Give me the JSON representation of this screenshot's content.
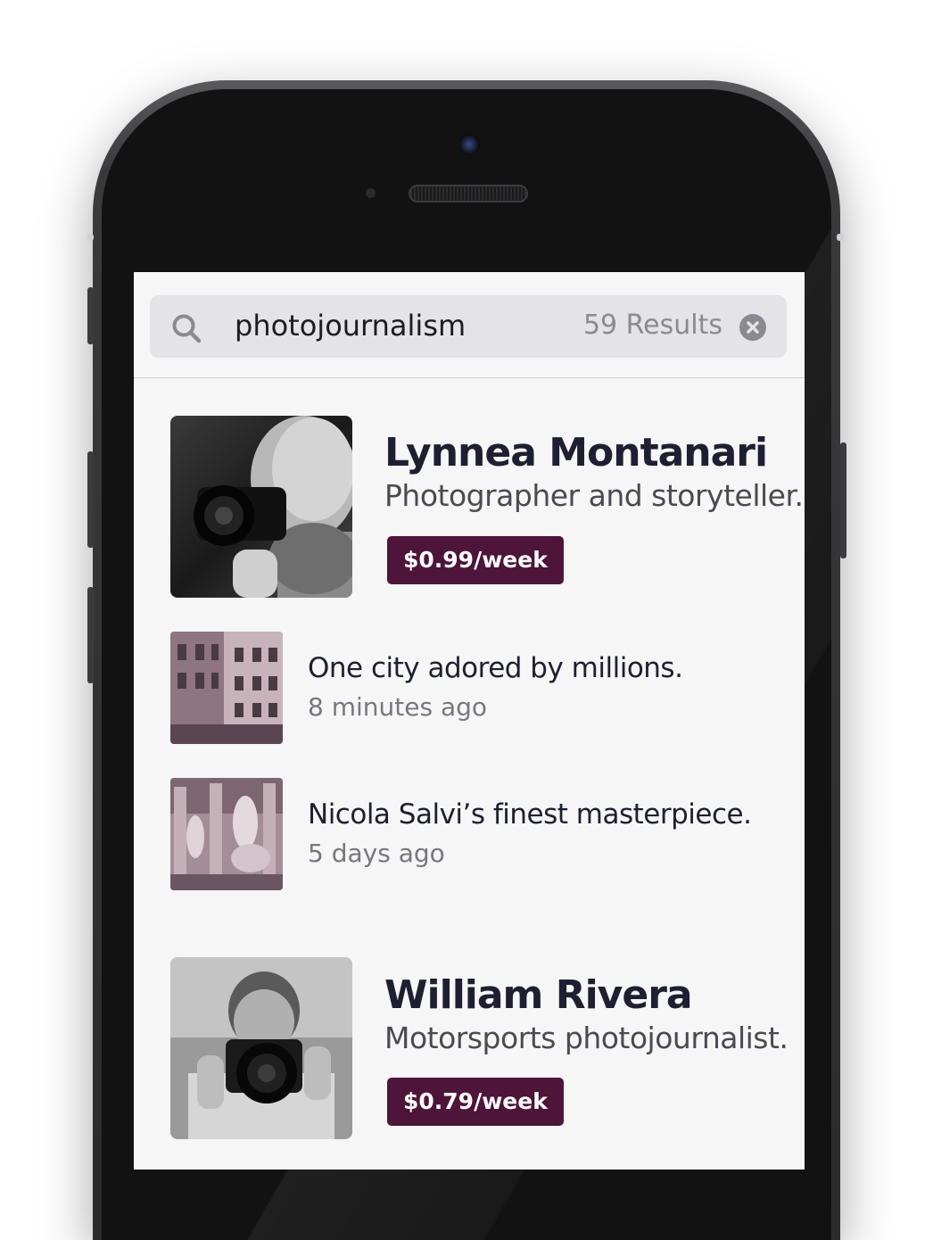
{
  "search": {
    "query": "photojournalism",
    "results_count": "59 Results"
  },
  "authors": [
    {
      "name": "Lynnea Montanari",
      "bio": "Photographer and storyteller.",
      "price": "$0.99/week",
      "stories": [
        {
          "title": "One city adored by millions.",
          "time": "8 minutes ago"
        },
        {
          "title": "Nicola Salvi’s finest masterpiece.",
          "time": "5 days ago"
        }
      ]
    },
    {
      "name": "William Rivera",
      "bio": "Motorsports photojournalist.",
      "price": "$0.79/week"
    }
  ],
  "colors": {
    "accent": "#4e1439",
    "screen_bg": "#f6f6f7",
    "search_bg": "#e4e4e6",
    "title_text": "#1e1f30"
  },
  "icons": {
    "search": "search-icon",
    "clear": "clear-icon"
  }
}
